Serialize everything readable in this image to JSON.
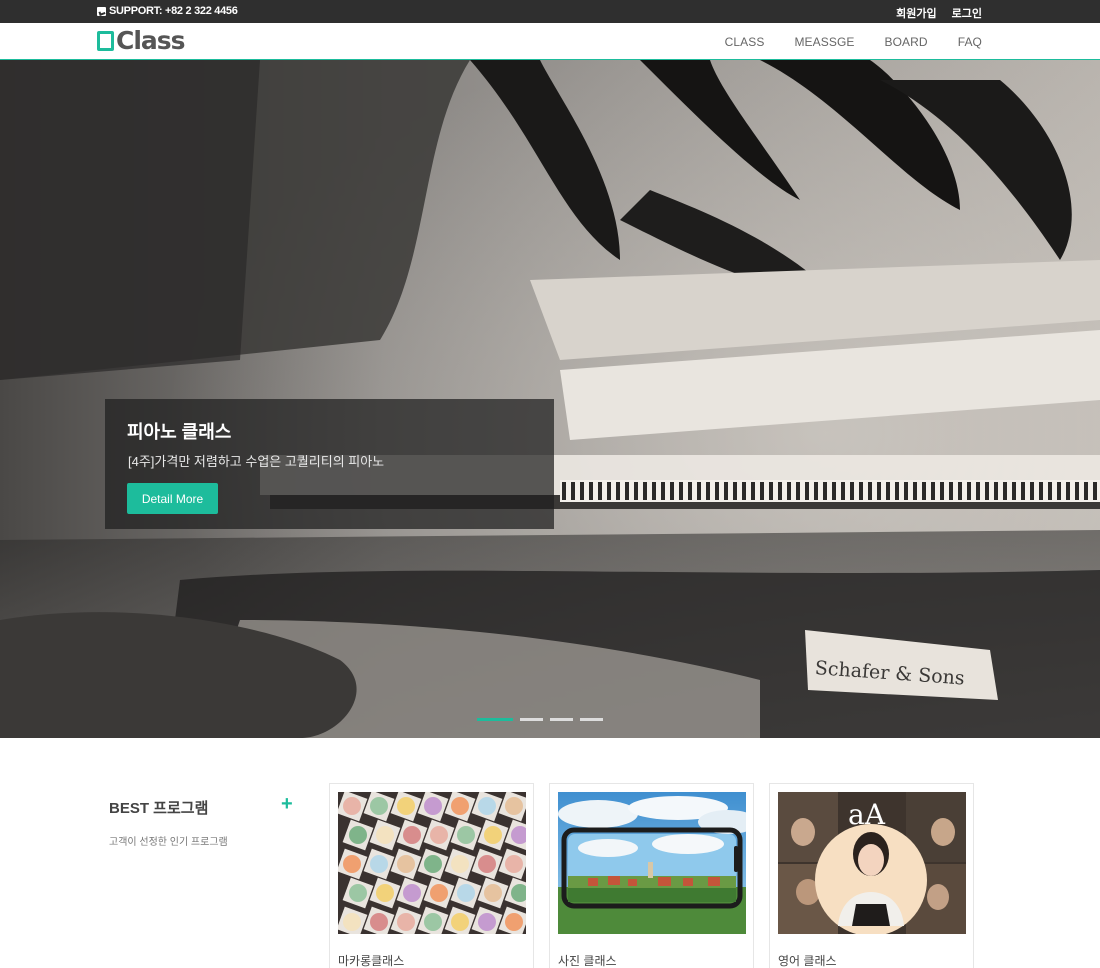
{
  "topbar": {
    "support": "SUPPORT: +82 2 322 4456",
    "signup": "회원가입",
    "login": "로그인"
  },
  "header": {
    "logo": "Class",
    "nav": [
      "CLASS",
      "MEASSGE",
      "BOARD",
      "FAQ"
    ]
  },
  "hero": {
    "title": "피아노 클래스",
    "subtitle": "[4주]가격만 저렴하고 수업은 고퀄리티의 피아노",
    "button": "Detail More",
    "nameplate": "Schafer & Sons",
    "slides": 4,
    "active_slide": 1
  },
  "best": {
    "title": "BEST 프로그램",
    "plus": "+",
    "subtitle": "고객이 선정한 인기 프로그램",
    "cards": [
      {
        "label": "마카롱클래스"
      },
      {
        "label": "사진 클래스"
      },
      {
        "label": "영어 클래스",
        "badge": "aA"
      }
    ]
  },
  "colors": {
    "accent": "#1dbc9c",
    "topbar": "#2f2f2f"
  }
}
